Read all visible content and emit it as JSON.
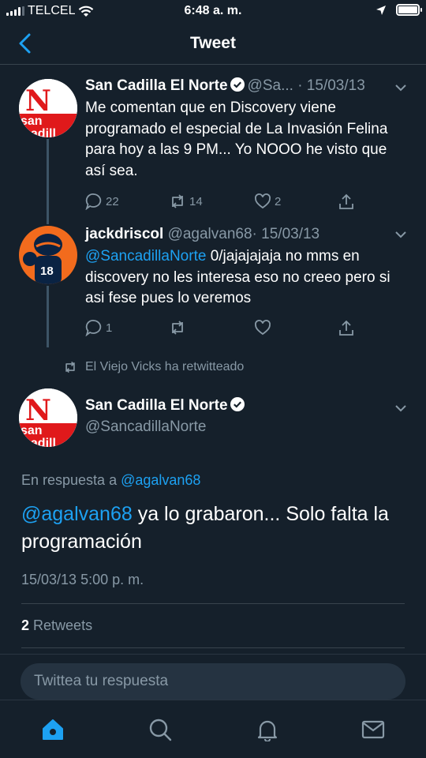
{
  "status_bar": {
    "carrier": "TELCEL",
    "time": "6:48 a. m."
  },
  "nav": {
    "title": "Tweet"
  },
  "tweets": [
    {
      "name": "San Cadilla El Norte",
      "handle": "@Sa...",
      "date": "· 15/03/13",
      "text": "Me comentan que en Discovery viene programado el especial de La Invasión Felina para hoy a las 9 PM... Yo NOOO he visto que así sea.",
      "replies": "22",
      "retweets": "14",
      "likes": "2",
      "avatar_text_top": "N",
      "avatar_text_bottom": "san cadilla"
    },
    {
      "name": "jackdriscol",
      "handle": "@agalvan68",
      "date": "· 15/03/13",
      "mention": "@SancadillaNorte",
      "text": " 0/jajajajaja no mms en discovery no les interesa eso no creeo pero si asi fese pues lo veremos",
      "replies": "1",
      "retweets": "",
      "likes": "",
      "jersey_number": "18"
    }
  ],
  "retweet_note": "El Viejo Vicks ha retwitteado",
  "main_tweet": {
    "name": "San Cadilla El Norte",
    "handle": "@SancadillaNorte",
    "reply_to_prefix": "En respuesta a",
    "reply_to_handle": "@agalvan68",
    "mention": "@agalvan68",
    "text": " ya lo grabaron... Solo falta la programación",
    "date": "15/03/13 5:00 p. m.",
    "retweet_count": "2",
    "retweet_label": "Retweets"
  },
  "reply_bar": {
    "placeholder": "Twittea tu respuesta"
  },
  "colors": {
    "background": "#15202b",
    "accent": "#1da1f2",
    "muted": "#8899a6",
    "divider": "#38444d"
  }
}
